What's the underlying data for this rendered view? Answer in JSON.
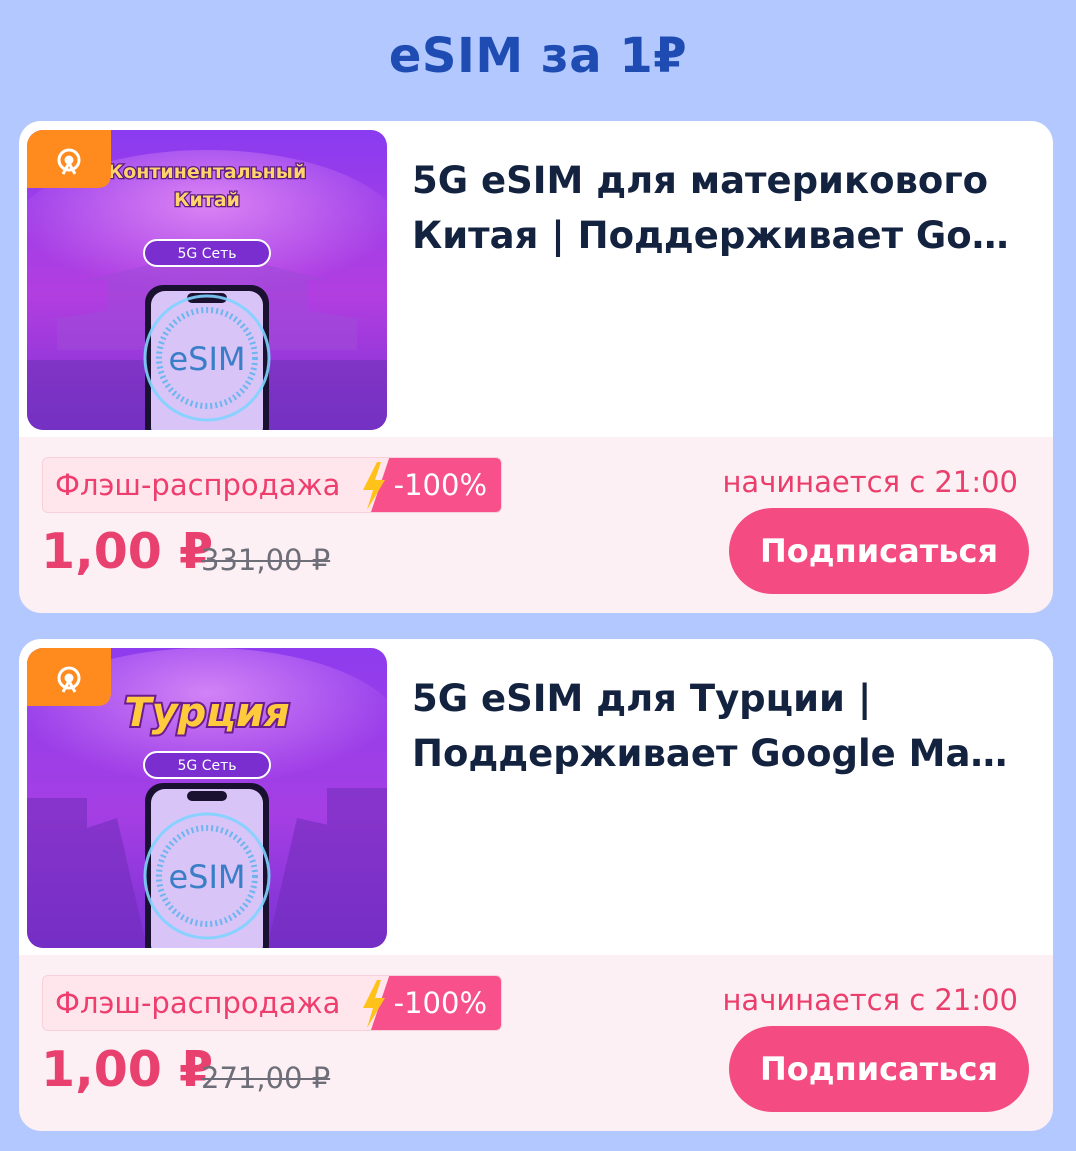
{
  "header": {
    "title": "eSIM за 1₽"
  },
  "products": [
    {
      "image_caption": "Континентальный Китай",
      "image_caption_lines": [
        "Континентальный",
        "Китай"
      ],
      "image_network": "5G Сеть",
      "image_esim": "eSIM",
      "title_line1": "5G eSIM для материкового",
      "title_line2": "Китая | Поддерживает Goog...",
      "flash_label": "Флэш-распродажа",
      "discount": "-100%",
      "price": "1,00 ₽",
      "old_price": "331,00 ₽",
      "start_text": "начинается с 21:00",
      "subscribe_label": "Подписаться"
    },
    {
      "image_caption": "Турция",
      "image_caption_lines": [
        "Турция"
      ],
      "image_network": "5G Сеть",
      "image_esim": "eSIM",
      "title_line1": "5G eSIM для Турции |",
      "title_line2": "Поддерживает Google Maps...",
      "flash_label": "Флэш-распродажа",
      "discount": "-100%",
      "price": "1,00 ₽",
      "old_price": "271,00 ₽",
      "start_text": "начинается с 21:00",
      "subscribe_label": "Подписаться"
    }
  ],
  "colors": {
    "background": "#b2c8ff",
    "title": "#1f4cb3",
    "accent_pink": "#f34b82",
    "price_pink": "#e8416f",
    "badge_orange": "#ff8a1e"
  }
}
